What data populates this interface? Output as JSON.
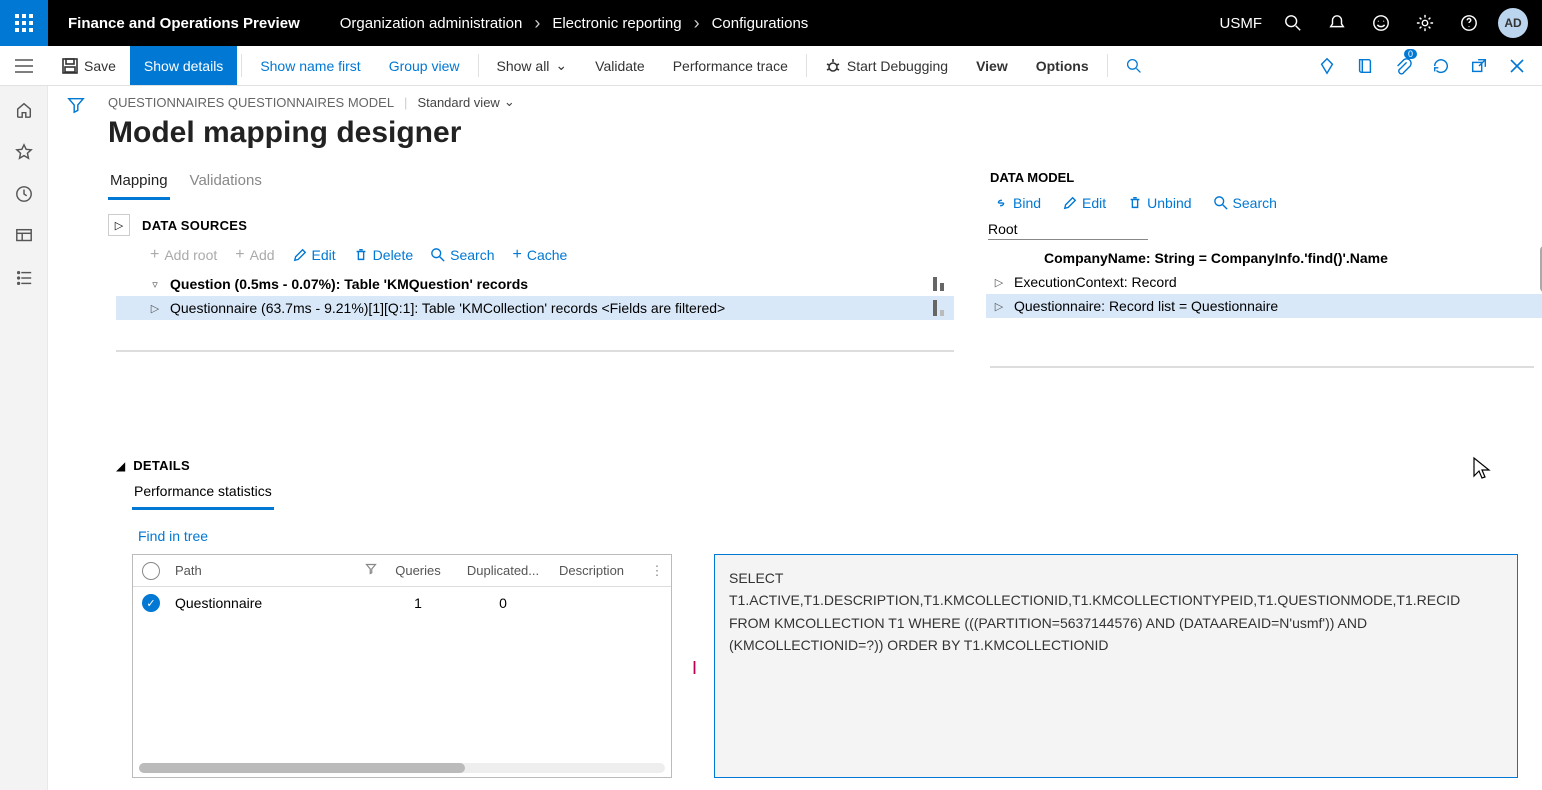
{
  "top": {
    "app_title": "Finance and Operations Preview",
    "breadcrumbs": [
      "Organization administration",
      "Electronic reporting",
      "Configurations"
    ],
    "company": "USMF",
    "avatar": "AD"
  },
  "actions": {
    "save": "Save",
    "show_details": "Show details",
    "show_name_first": "Show name first",
    "group_view": "Group view",
    "show_all": "Show all",
    "validate": "Validate",
    "perf_trace": "Performance trace",
    "start_debug": "Start Debugging",
    "view": "View",
    "options": "Options",
    "attach_badge": "0"
  },
  "doc": {
    "path": "QUESTIONNAIRES QUESTIONNAIRES MODEL",
    "view_name": "Standard view",
    "title": "Model mapping designer"
  },
  "tabs": {
    "mapping": "Mapping",
    "validations": "Validations"
  },
  "datasources": {
    "title": "DATA SOURCES",
    "add_root": "Add root",
    "add": "Add",
    "edit": "Edit",
    "delete": "Delete",
    "search": "Search",
    "cache": "Cache",
    "rows": [
      "Question (0.5ms - 0.07%): Table 'KMQuestion' records",
      "Questionnaire (63.7ms - 9.21%)[1][Q:1]: Table 'KMCollection' records <Fields are filtered>"
    ]
  },
  "datamodel": {
    "title": "DATA MODEL",
    "bind": "Bind",
    "edit": "Edit",
    "unbind": "Unbind",
    "search": "Search",
    "root": "Root",
    "rows": [
      "CompanyName: String = CompanyInfo.'find()'.Name",
      "ExecutionContext: Record",
      "Questionnaire: Record list = Questionnaire"
    ]
  },
  "details": {
    "title": "DETAILS",
    "tab": "Performance statistics",
    "find_in_tree": "Find in tree",
    "grid": {
      "h_path": "Path",
      "h_queries": "Queries",
      "h_dup": "Duplicated...",
      "h_desc": "Description",
      "row": {
        "path": "Questionnaire",
        "queries": "1",
        "dup": "0"
      }
    },
    "sql": "SELECT T1.ACTIVE,T1.DESCRIPTION,T1.KMCOLLECTIONID,T1.KMCOLLECTIONTYPEID,T1.QUESTIONMODE,T1.RECID FROM KMCOLLECTION T1 WHERE (((PARTITION=5637144576) AND (DATAAREAID=N'usmf')) AND (KMCOLLECTIONID=?)) ORDER BY T1.KMCOLLECTIONID"
  }
}
